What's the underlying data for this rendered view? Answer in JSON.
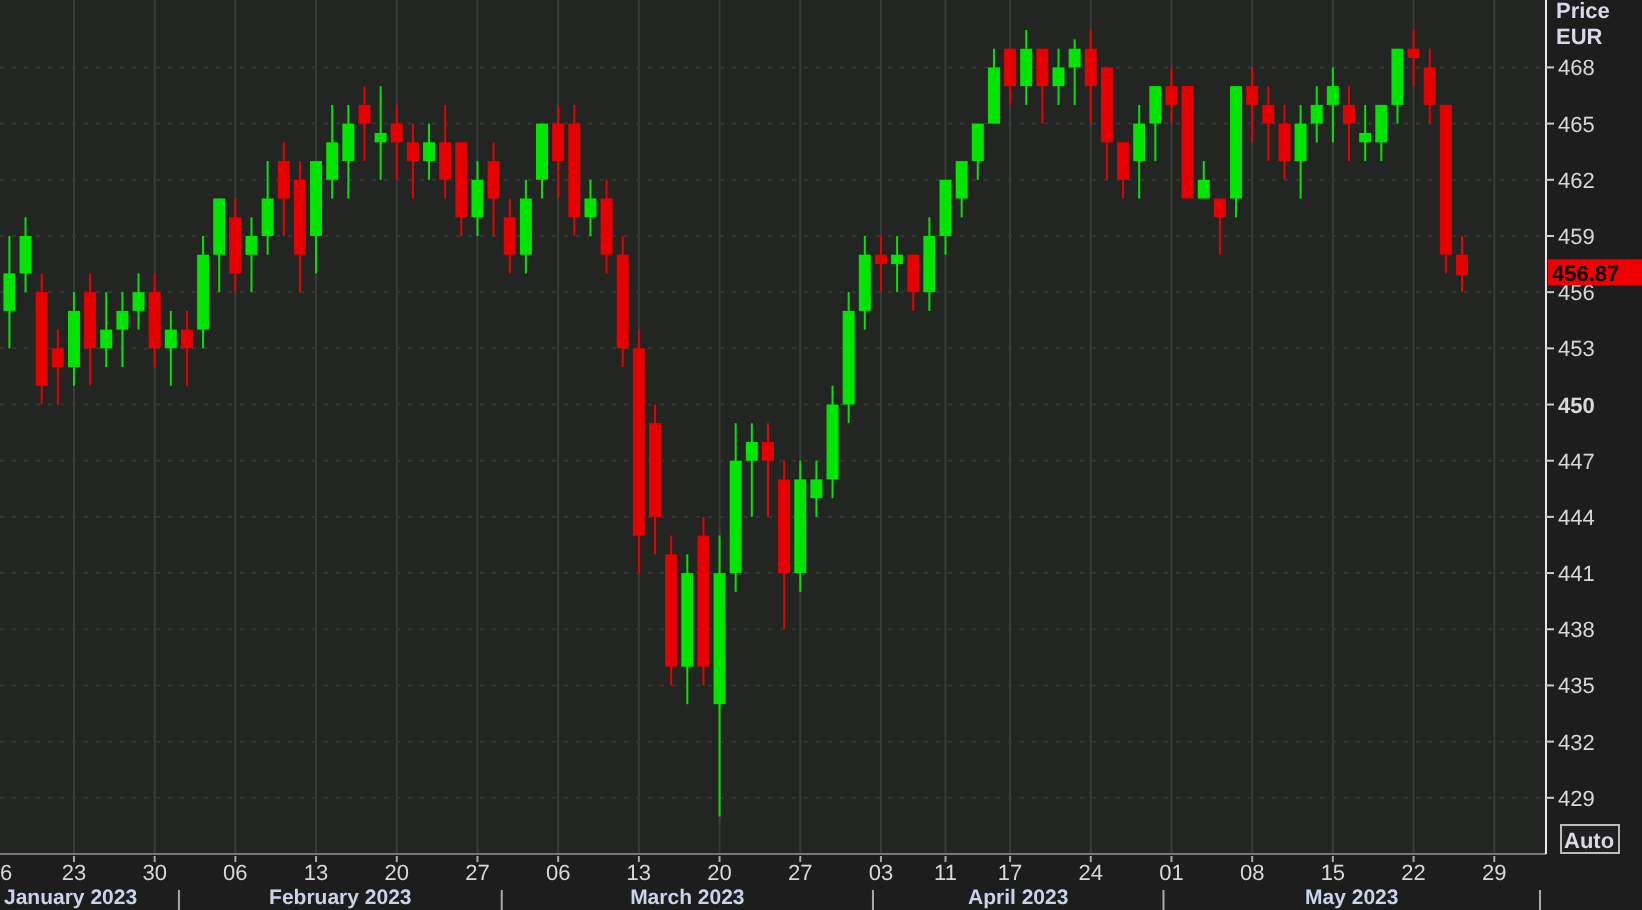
{
  "chart": {
    "axis_title": [
      "Price",
      "EUR"
    ],
    "last_price": "456.87",
    "auto_button": "Auto",
    "edge_tick": "6",
    "months": [
      "January 2023",
      "February 2023",
      "March 2023",
      "April 2023",
      "May 2023"
    ],
    "chart_data": {
      "type": "candlestick",
      "grid": true,
      "categories": [
        null,
        null,
        null,
        null,
        "23",
        null,
        null,
        null,
        null,
        "30",
        null,
        null,
        null,
        null,
        "06",
        null,
        null,
        null,
        null,
        "13",
        null,
        null,
        null,
        null,
        "20",
        null,
        null,
        null,
        null,
        "27",
        null,
        null,
        null,
        null,
        "06",
        null,
        null,
        null,
        null,
        "13",
        null,
        null,
        null,
        null,
        "20",
        null,
        null,
        null,
        null,
        "27",
        null,
        null,
        null,
        null,
        "03",
        null,
        null,
        null,
        "11",
        null,
        null,
        null,
        "17",
        null,
        null,
        null,
        null,
        "24",
        null,
        null,
        null,
        null,
        "01",
        null,
        null,
        null,
        null,
        "08",
        null,
        null,
        null,
        null,
        "15",
        null,
        null,
        null,
        null,
        "22",
        null,
        null,
        null,
        null,
        "29"
      ],
      "ohlc": [
        [
          455,
          459,
          453,
          457
        ],
        [
          457,
          460,
          456,
          459
        ],
        [
          456,
          457,
          450,
          451
        ],
        [
          453,
          454,
          450,
          452
        ],
        [
          452,
          456,
          451,
          455
        ],
        [
          456,
          457,
          451,
          453
        ],
        [
          453,
          456,
          452,
          454
        ],
        [
          454,
          456,
          452,
          455
        ],
        [
          455,
          457,
          454,
          456
        ],
        [
          456,
          457,
          452,
          453
        ],
        [
          453,
          455,
          451,
          454
        ],
        [
          454,
          455,
          451,
          453
        ],
        [
          454,
          459,
          453,
          458
        ],
        [
          458,
          461,
          456,
          461
        ],
        [
          460,
          461,
          456,
          457
        ],
        [
          458,
          460,
          456,
          459
        ],
        [
          459,
          463,
          458,
          461
        ],
        [
          463,
          464,
          459,
          461
        ],
        [
          462,
          463,
          456,
          458
        ],
        [
          459,
          463,
          457,
          463
        ],
        [
          462,
          466,
          461,
          464
        ],
        [
          463,
          466,
          461,
          465
        ],
        [
          466,
          467,
          463,
          465
        ],
        [
          464,
          467,
          462,
          464.5
        ],
        [
          465,
          466,
          462,
          464
        ],
        [
          464,
          465,
          461,
          463
        ],
        [
          463,
          465,
          462,
          464
        ],
        [
          464,
          466,
          461,
          462
        ],
        [
          464,
          464,
          459,
          460
        ],
        [
          460,
          463,
          459,
          462
        ],
        [
          463,
          464,
          459,
          461
        ],
        [
          460,
          461,
          457,
          458
        ],
        [
          458,
          462,
          457,
          461
        ],
        [
          462,
          465,
          461,
          465
        ],
        [
          465,
          466,
          461,
          463
        ],
        [
          465,
          466,
          459,
          460
        ],
        [
          460,
          462,
          459,
          461
        ],
        [
          461,
          462,
          457,
          458
        ],
        [
          458,
          459,
          452,
          453
        ],
        [
          453,
          454,
          441,
          443
        ],
        [
          449,
          450,
          442,
          444
        ],
        [
          442,
          443,
          435,
          436
        ],
        [
          436,
          442,
          434,
          441
        ],
        [
          443,
          444,
          435,
          436
        ],
        [
          434,
          443,
          428,
          441
        ],
        [
          441,
          449,
          440,
          447
        ],
        [
          447,
          449,
          444,
          448
        ],
        [
          448,
          449,
          444,
          447
        ],
        [
          446,
          447,
          438,
          441
        ],
        [
          441,
          447,
          440,
          446
        ],
        [
          445,
          447,
          444,
          446
        ],
        [
          446,
          451,
          445,
          450
        ],
        [
          450,
          456,
          449,
          455
        ],
        [
          455,
          459,
          454,
          458
        ],
        [
          458,
          459,
          456,
          457.5
        ],
        [
          457.5,
          459,
          456,
          458
        ],
        [
          458,
          458,
          455,
          456
        ],
        [
          456,
          460,
          455,
          459
        ],
        [
          459,
          462,
          458,
          462
        ],
        [
          461,
          463,
          460,
          463
        ],
        [
          463,
          465,
          462,
          465
        ],
        [
          465,
          469,
          465,
          468
        ],
        [
          469,
          469,
          466,
          467
        ],
        [
          467,
          470,
          466,
          469
        ],
        [
          469,
          469,
          465,
          467
        ],
        [
          467,
          469,
          466,
          468
        ],
        [
          468,
          469.5,
          466,
          469
        ],
        [
          469,
          470,
          465,
          467
        ],
        [
          468,
          468,
          462,
          464
        ],
        [
          464,
          464,
          461,
          462
        ],
        [
          463,
          466,
          461,
          465
        ],
        [
          465,
          467,
          463,
          467
        ],
        [
          467,
          468,
          465,
          466
        ],
        [
          467,
          467,
          461,
          461
        ],
        [
          461,
          463,
          461,
          462
        ],
        [
          461,
          461,
          458,
          460
        ],
        [
          461,
          467,
          460,
          467
        ],
        [
          467,
          468,
          464,
          466
        ],
        [
          466,
          467,
          463,
          465
        ],
        [
          465,
          466,
          462,
          463
        ],
        [
          463,
          466,
          461,
          465
        ],
        [
          465,
          467,
          464,
          466
        ],
        [
          466,
          468,
          464,
          467
        ],
        [
          466,
          467,
          463,
          465
        ],
        [
          464,
          466,
          463,
          464.5
        ],
        [
          464,
          466,
          463,
          466
        ],
        [
          466,
          469,
          465,
          469
        ],
        [
          469,
          470,
          467,
          468.5
        ],
        [
          468,
          469,
          465,
          466
        ],
        [
          466,
          466,
          457,
          458
        ],
        [
          458,
          459,
          456,
          456.9
        ],
        null,
        null
      ],
      "ylim": [
        426,
        471.6
      ],
      "yticks": [
        468,
        465,
        462,
        459,
        456,
        453,
        450,
        447,
        444,
        441,
        438,
        435,
        432,
        429
      ]
    }
  }
}
